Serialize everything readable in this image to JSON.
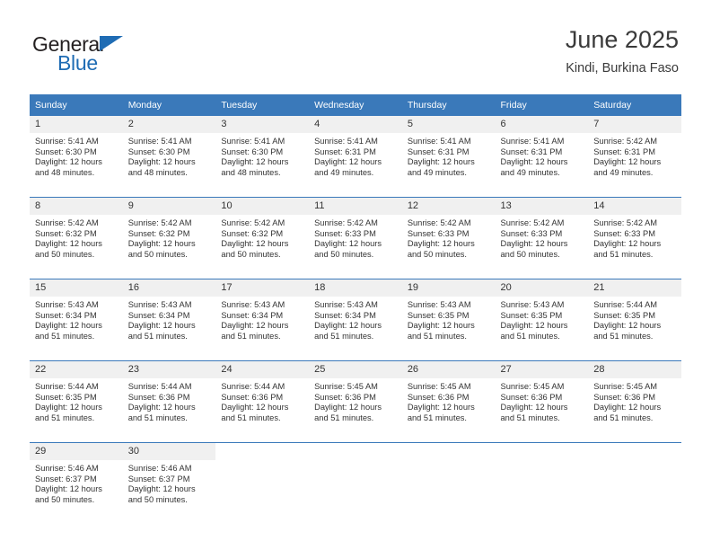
{
  "brand": {
    "name_part1": "General",
    "name_part2": "Blue",
    "triangle_icon": "logo-triangle-icon",
    "accent_color": "#1f6cb4"
  },
  "header": {
    "title": "June 2025",
    "subtitle": "Kindi, Burkina Faso"
  },
  "calendar": {
    "header_bg": "#3a79ba",
    "daynum_bg": "#f0f0f0",
    "weekday_headers": [
      "Sunday",
      "Monday",
      "Tuesday",
      "Wednesday",
      "Thursday",
      "Friday",
      "Saturday"
    ],
    "weeks": [
      [
        {
          "day": "1",
          "sunrise": "Sunrise: 5:41 AM",
          "sunset": "Sunset: 6:30 PM",
          "daylight": "Daylight: 12 hours and 48 minutes."
        },
        {
          "day": "2",
          "sunrise": "Sunrise: 5:41 AM",
          "sunset": "Sunset: 6:30 PM",
          "daylight": "Daylight: 12 hours and 48 minutes."
        },
        {
          "day": "3",
          "sunrise": "Sunrise: 5:41 AM",
          "sunset": "Sunset: 6:30 PM",
          "daylight": "Daylight: 12 hours and 48 minutes."
        },
        {
          "day": "4",
          "sunrise": "Sunrise: 5:41 AM",
          "sunset": "Sunset: 6:31 PM",
          "daylight": "Daylight: 12 hours and 49 minutes."
        },
        {
          "day": "5",
          "sunrise": "Sunrise: 5:41 AM",
          "sunset": "Sunset: 6:31 PM",
          "daylight": "Daylight: 12 hours and 49 minutes."
        },
        {
          "day": "6",
          "sunrise": "Sunrise: 5:41 AM",
          "sunset": "Sunset: 6:31 PM",
          "daylight": "Daylight: 12 hours and 49 minutes."
        },
        {
          "day": "7",
          "sunrise": "Sunrise: 5:42 AM",
          "sunset": "Sunset: 6:31 PM",
          "daylight": "Daylight: 12 hours and 49 minutes."
        }
      ],
      [
        {
          "day": "8",
          "sunrise": "Sunrise: 5:42 AM",
          "sunset": "Sunset: 6:32 PM",
          "daylight": "Daylight: 12 hours and 50 minutes."
        },
        {
          "day": "9",
          "sunrise": "Sunrise: 5:42 AM",
          "sunset": "Sunset: 6:32 PM",
          "daylight": "Daylight: 12 hours and 50 minutes."
        },
        {
          "day": "10",
          "sunrise": "Sunrise: 5:42 AM",
          "sunset": "Sunset: 6:32 PM",
          "daylight": "Daylight: 12 hours and 50 minutes."
        },
        {
          "day": "11",
          "sunrise": "Sunrise: 5:42 AM",
          "sunset": "Sunset: 6:33 PM",
          "daylight": "Daylight: 12 hours and 50 minutes."
        },
        {
          "day": "12",
          "sunrise": "Sunrise: 5:42 AM",
          "sunset": "Sunset: 6:33 PM",
          "daylight": "Daylight: 12 hours and 50 minutes."
        },
        {
          "day": "13",
          "sunrise": "Sunrise: 5:42 AM",
          "sunset": "Sunset: 6:33 PM",
          "daylight": "Daylight: 12 hours and 50 minutes."
        },
        {
          "day": "14",
          "sunrise": "Sunrise: 5:42 AM",
          "sunset": "Sunset: 6:33 PM",
          "daylight": "Daylight: 12 hours and 51 minutes."
        }
      ],
      [
        {
          "day": "15",
          "sunrise": "Sunrise: 5:43 AM",
          "sunset": "Sunset: 6:34 PM",
          "daylight": "Daylight: 12 hours and 51 minutes."
        },
        {
          "day": "16",
          "sunrise": "Sunrise: 5:43 AM",
          "sunset": "Sunset: 6:34 PM",
          "daylight": "Daylight: 12 hours and 51 minutes."
        },
        {
          "day": "17",
          "sunrise": "Sunrise: 5:43 AM",
          "sunset": "Sunset: 6:34 PM",
          "daylight": "Daylight: 12 hours and 51 minutes."
        },
        {
          "day": "18",
          "sunrise": "Sunrise: 5:43 AM",
          "sunset": "Sunset: 6:34 PM",
          "daylight": "Daylight: 12 hours and 51 minutes."
        },
        {
          "day": "19",
          "sunrise": "Sunrise: 5:43 AM",
          "sunset": "Sunset: 6:35 PM",
          "daylight": "Daylight: 12 hours and 51 minutes."
        },
        {
          "day": "20",
          "sunrise": "Sunrise: 5:43 AM",
          "sunset": "Sunset: 6:35 PM",
          "daylight": "Daylight: 12 hours and 51 minutes."
        },
        {
          "day": "21",
          "sunrise": "Sunrise: 5:44 AM",
          "sunset": "Sunset: 6:35 PM",
          "daylight": "Daylight: 12 hours and 51 minutes."
        }
      ],
      [
        {
          "day": "22",
          "sunrise": "Sunrise: 5:44 AM",
          "sunset": "Sunset: 6:35 PM",
          "daylight": "Daylight: 12 hours and 51 minutes."
        },
        {
          "day": "23",
          "sunrise": "Sunrise: 5:44 AM",
          "sunset": "Sunset: 6:36 PM",
          "daylight": "Daylight: 12 hours and 51 minutes."
        },
        {
          "day": "24",
          "sunrise": "Sunrise: 5:44 AM",
          "sunset": "Sunset: 6:36 PM",
          "daylight": "Daylight: 12 hours and 51 minutes."
        },
        {
          "day": "25",
          "sunrise": "Sunrise: 5:45 AM",
          "sunset": "Sunset: 6:36 PM",
          "daylight": "Daylight: 12 hours and 51 minutes."
        },
        {
          "day": "26",
          "sunrise": "Sunrise: 5:45 AM",
          "sunset": "Sunset: 6:36 PM",
          "daylight": "Daylight: 12 hours and 51 minutes."
        },
        {
          "day": "27",
          "sunrise": "Sunrise: 5:45 AM",
          "sunset": "Sunset: 6:36 PM",
          "daylight": "Daylight: 12 hours and 51 minutes."
        },
        {
          "day": "28",
          "sunrise": "Sunrise: 5:45 AM",
          "sunset": "Sunset: 6:36 PM",
          "daylight": "Daylight: 12 hours and 51 minutes."
        }
      ],
      [
        {
          "day": "29",
          "sunrise": "Sunrise: 5:46 AM",
          "sunset": "Sunset: 6:37 PM",
          "daylight": "Daylight: 12 hours and 50 minutes."
        },
        {
          "day": "30",
          "sunrise": "Sunrise: 5:46 AM",
          "sunset": "Sunset: 6:37 PM",
          "daylight": "Daylight: 12 hours and 50 minutes."
        },
        {
          "day": "",
          "sunrise": "",
          "sunset": "",
          "daylight": ""
        },
        {
          "day": "",
          "sunrise": "",
          "sunset": "",
          "daylight": ""
        },
        {
          "day": "",
          "sunrise": "",
          "sunset": "",
          "daylight": ""
        },
        {
          "day": "",
          "sunrise": "",
          "sunset": "",
          "daylight": ""
        },
        {
          "day": "",
          "sunrise": "",
          "sunset": "",
          "daylight": ""
        }
      ]
    ]
  }
}
